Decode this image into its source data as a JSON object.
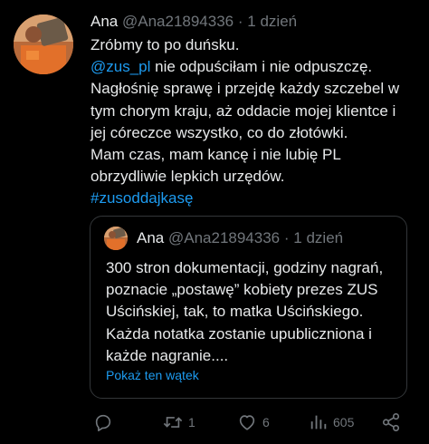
{
  "tweet": {
    "author_name": "Ana",
    "handle": "@Ana21894336",
    "separator": "·",
    "time": "1 dzień",
    "lines": [
      {
        "text": "Zróbmy to po duńsku."
      },
      {
        "mention": "@zus_pl",
        "text": " nie odpuściłam i nie odpuszczę."
      },
      {
        "text": "Nagłośnię sprawę i przejdę każdy szczebel w"
      },
      {
        "text": "tym chorym kraju, aż oddacie mojej klientce i"
      },
      {
        "text": "jej córeczce wszystko, co do złotówki."
      },
      {
        "text": "Mam czas, mam kancę i nie lubię PL"
      },
      {
        "text": "obrzydliwie lepkich urzędów."
      },
      {
        "hashtag": "#zusoddajkasę"
      }
    ]
  },
  "quote": {
    "author_name": "Ana",
    "handle": "@Ana21894336",
    "separator": "·",
    "time": "1 dzień",
    "lines": [
      "300 stron dokumentacji, godziny nagrań,",
      "poznacie „postawę” kobiety prezes ZUS",
      "Uścińskiej, tak, to matka Uścińskiego.",
      "Każda notatka zostanie upubliczniona i",
      "każde nagranie...."
    ],
    "show_thread": "Pokaż ten wątek"
  },
  "actions": {
    "reply": {
      "icon": "reply-icon",
      "count": ""
    },
    "retweet": {
      "icon": "retweet-icon",
      "count": "1"
    },
    "like": {
      "icon": "heart-icon",
      "count": "6"
    },
    "views": {
      "icon": "views-icon",
      "count": "605"
    },
    "share": {
      "icon": "share-icon",
      "count": ""
    }
  },
  "colors": {
    "background": "#000000",
    "text": "#e7e9ea",
    "muted": "#71767b",
    "link": "#1d9bf0",
    "border": "#333639"
  }
}
